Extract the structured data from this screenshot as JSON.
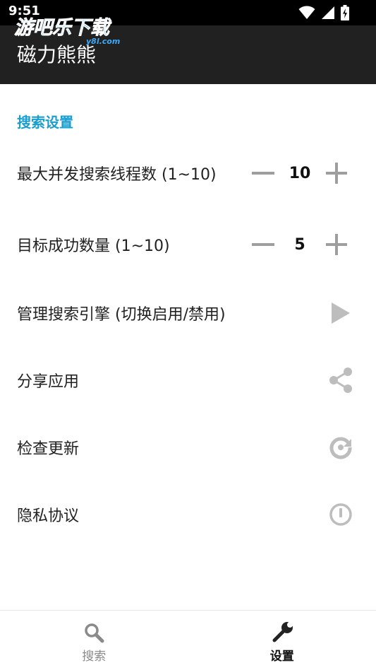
{
  "status_bar": {
    "time": "9:51",
    "icons": [
      "wifi-icon",
      "cell-signal-icon",
      "battery-charging-icon"
    ]
  },
  "app_bar": {
    "title": "磁力熊熊"
  },
  "watermark": {
    "text": "游吧乐下载",
    "subtext": "y8l.com"
  },
  "settings": {
    "section_title": "搜索设置",
    "threads": {
      "label": "最大并发搜索线程数 (1~10)",
      "value": "10"
    },
    "target": {
      "label": "目标成功数量 (1~10)",
      "value": "5"
    },
    "engines": {
      "label": "管理搜索引擎 (切换启用/禁用)",
      "icon": "play-arrow-icon"
    },
    "share": {
      "label": "分享应用",
      "icon": "share-icon"
    },
    "update": {
      "label": "检查更新",
      "icon": "refresh-icon"
    },
    "privacy": {
      "label": "隐私协议",
      "icon": "power-icon"
    }
  },
  "bottom_nav": {
    "items": [
      {
        "label": "搜索",
        "icon": "search-icon",
        "active": false
      },
      {
        "label": "设置",
        "icon": "wrench-icon",
        "active": true
      }
    ]
  },
  "colors": {
    "accent": "#1a9ed0",
    "app_bar": "#212121",
    "icon_gray": "#bdbdbd",
    "stepper_gray": "#9e9e9e"
  }
}
